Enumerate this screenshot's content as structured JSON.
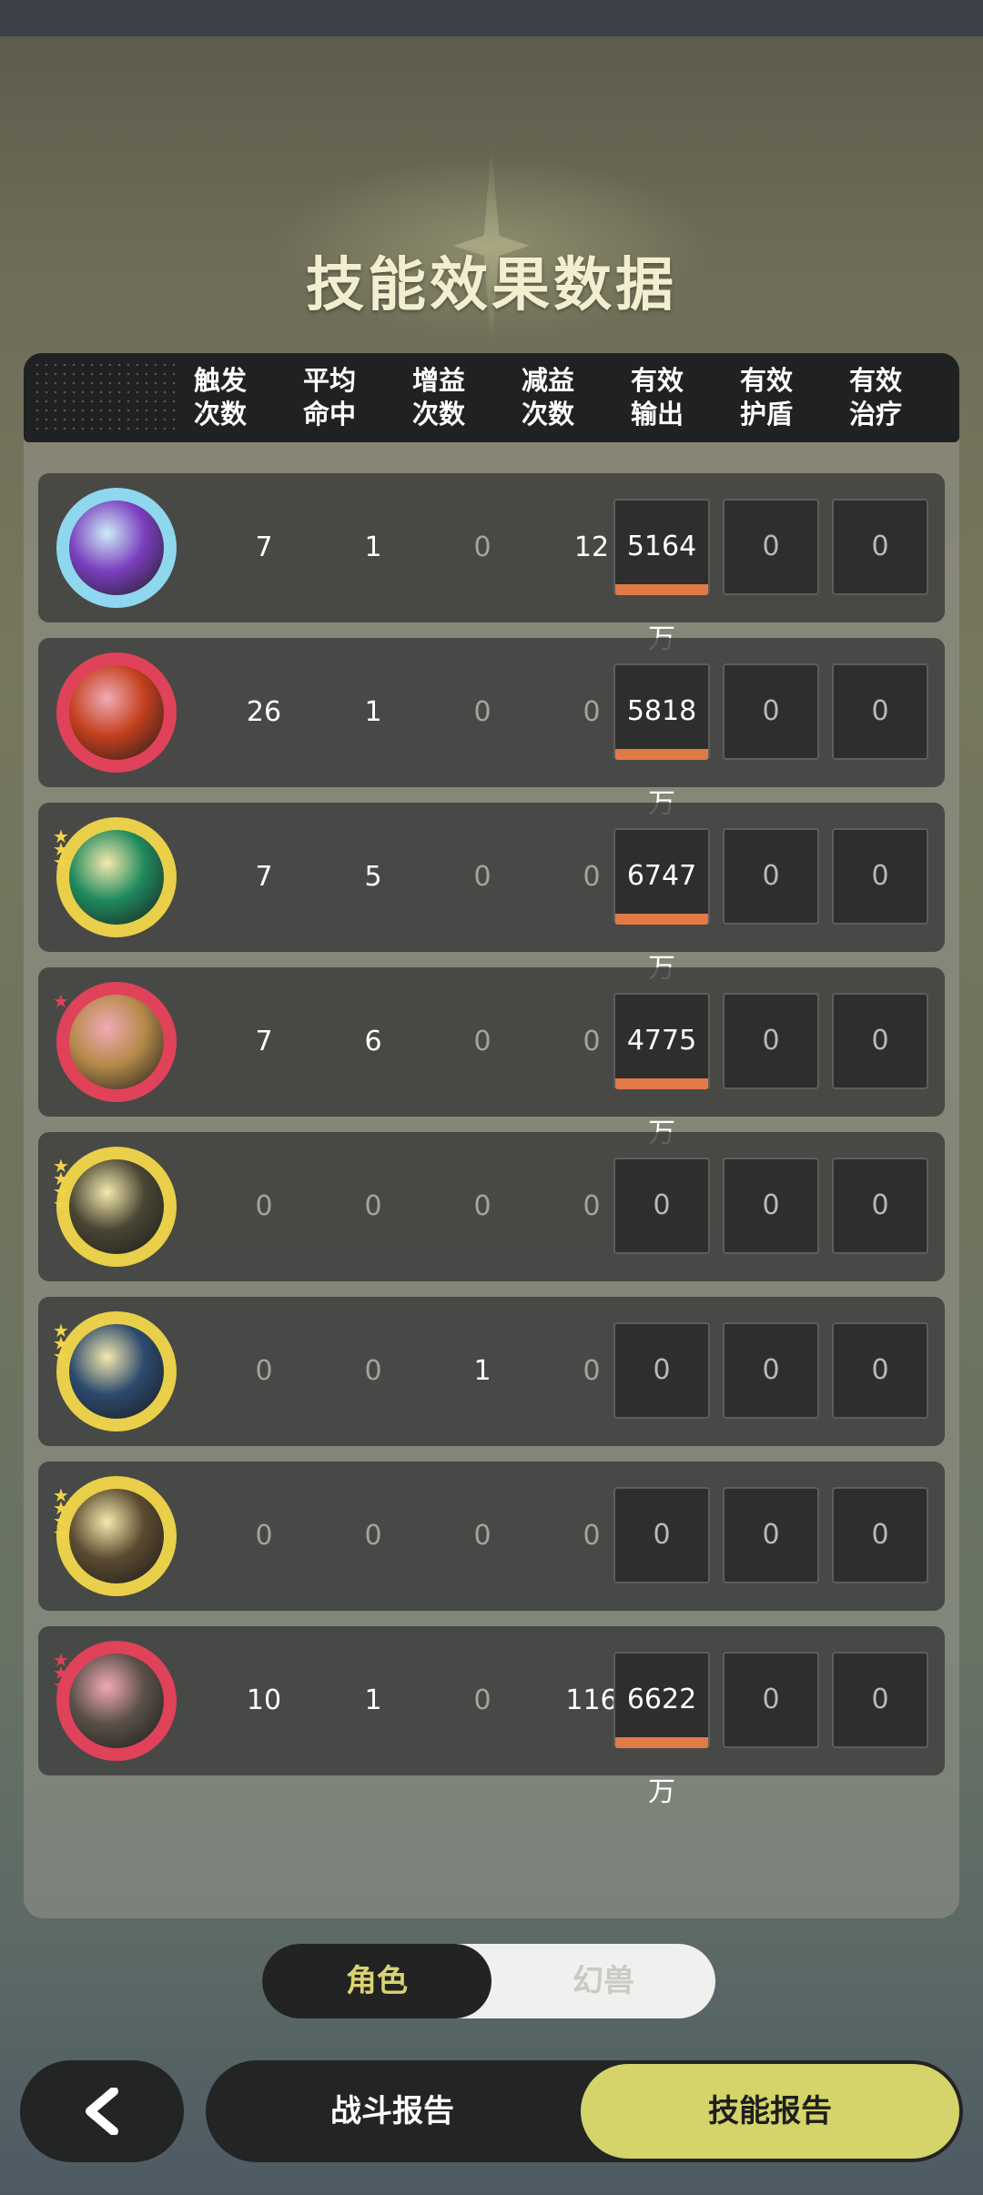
{
  "page": {
    "title": "技能效果数据"
  },
  "columns": [
    {
      "line1": "触发",
      "line2": "次数"
    },
    {
      "line1": "平均",
      "line2": "命中"
    },
    {
      "line1": "增益",
      "line2": "次数"
    },
    {
      "line1": "减益",
      "line2": "次数"
    },
    {
      "line1": "有效",
      "line2": "输出"
    },
    {
      "line1": "有效",
      "line2": "护盾"
    },
    {
      "line1": "有效",
      "line2": "治疗"
    }
  ],
  "rows": [
    {
      "icon": "purple-heart-skill-icon",
      "ring": "#8fd7ee",
      "inner": "#7b3fbf",
      "stars": 0,
      "star_color": "",
      "trigger": "7",
      "avg_hit": "1",
      "buff": "0",
      "debuff": "12",
      "output": "5164万",
      "output_share": 1.0,
      "shield": "0",
      "heal": "0"
    },
    {
      "icon": "fire-swirl-skill-icon",
      "ring": "#e0425a",
      "inner": "#c4401e",
      "stars": 0,
      "star_color": "",
      "trigger": "26",
      "avg_hit": "1",
      "buff": "0",
      "debuff": "0",
      "output": "5818万",
      "output_share": 1.0,
      "shield": "0",
      "heal": "0"
    },
    {
      "icon": "jade-swirl-skill-icon",
      "ring": "#e9cf4a",
      "inner": "#1f8a5e",
      "stars": 3,
      "star_color": "gold",
      "trigger": "7",
      "avg_hit": "5",
      "buff": "0",
      "debuff": "0",
      "output": "6747万",
      "output_share": 1.0,
      "shield": "0",
      "heal": "0"
    },
    {
      "icon": "golden-orb-skill-icon",
      "ring": "#e0425a",
      "inner": "#b58a4a",
      "stars": 1,
      "star_color": "red",
      "trigger": "7",
      "avg_hit": "6",
      "buff": "0",
      "debuff": "0",
      "output": "4775万",
      "output_share": 1.0,
      "shield": "0",
      "heal": "0"
    },
    {
      "icon": "eye-emblem-skill-icon",
      "ring": "#e9cf4a",
      "inner": "#4a4634",
      "stars": 4,
      "star_color": "gold",
      "trigger": "0",
      "avg_hit": "0",
      "buff": "0",
      "debuff": "0",
      "output": "0",
      "output_share": 0,
      "shield": "0",
      "heal": "0"
    },
    {
      "icon": "blue-crest-skill-icon",
      "ring": "#e9cf4a",
      "inner": "#2c4a6e",
      "stars": 3,
      "star_color": "gold",
      "trigger": "0",
      "avg_hit": "0",
      "buff": "1",
      "debuff": "0",
      "output": "0",
      "output_share": 0,
      "shield": "0",
      "heal": "0"
    },
    {
      "icon": "bronze-vortex-skill-icon",
      "ring": "#e9cf4a",
      "inner": "#5a4a30",
      "stars": 4,
      "star_color": "gold",
      "trigger": "0",
      "avg_hit": "0",
      "buff": "0",
      "debuff": "0",
      "output": "0",
      "output_share": 0,
      "shield": "0",
      "heal": "0"
    },
    {
      "icon": "maple-leaf-skill-icon",
      "ring": "#e0425a",
      "inner": "#5a5048",
      "stars": 3,
      "star_color": "red",
      "trigger": "10",
      "avg_hit": "1",
      "buff": "0",
      "debuff": "116",
      "output": "6622万",
      "output_share": 1.0,
      "shield": "0",
      "heal": "0"
    }
  ],
  "toggle": {
    "active": "角色",
    "inactive": "幻兽"
  },
  "nav": {
    "back_icon": "chevron-left-icon",
    "battle_report": "战斗报告",
    "skill_report": "技能报告"
  },
  "colors": {
    "accent": "#d4d46a",
    "output_bar": "#e27a46"
  }
}
